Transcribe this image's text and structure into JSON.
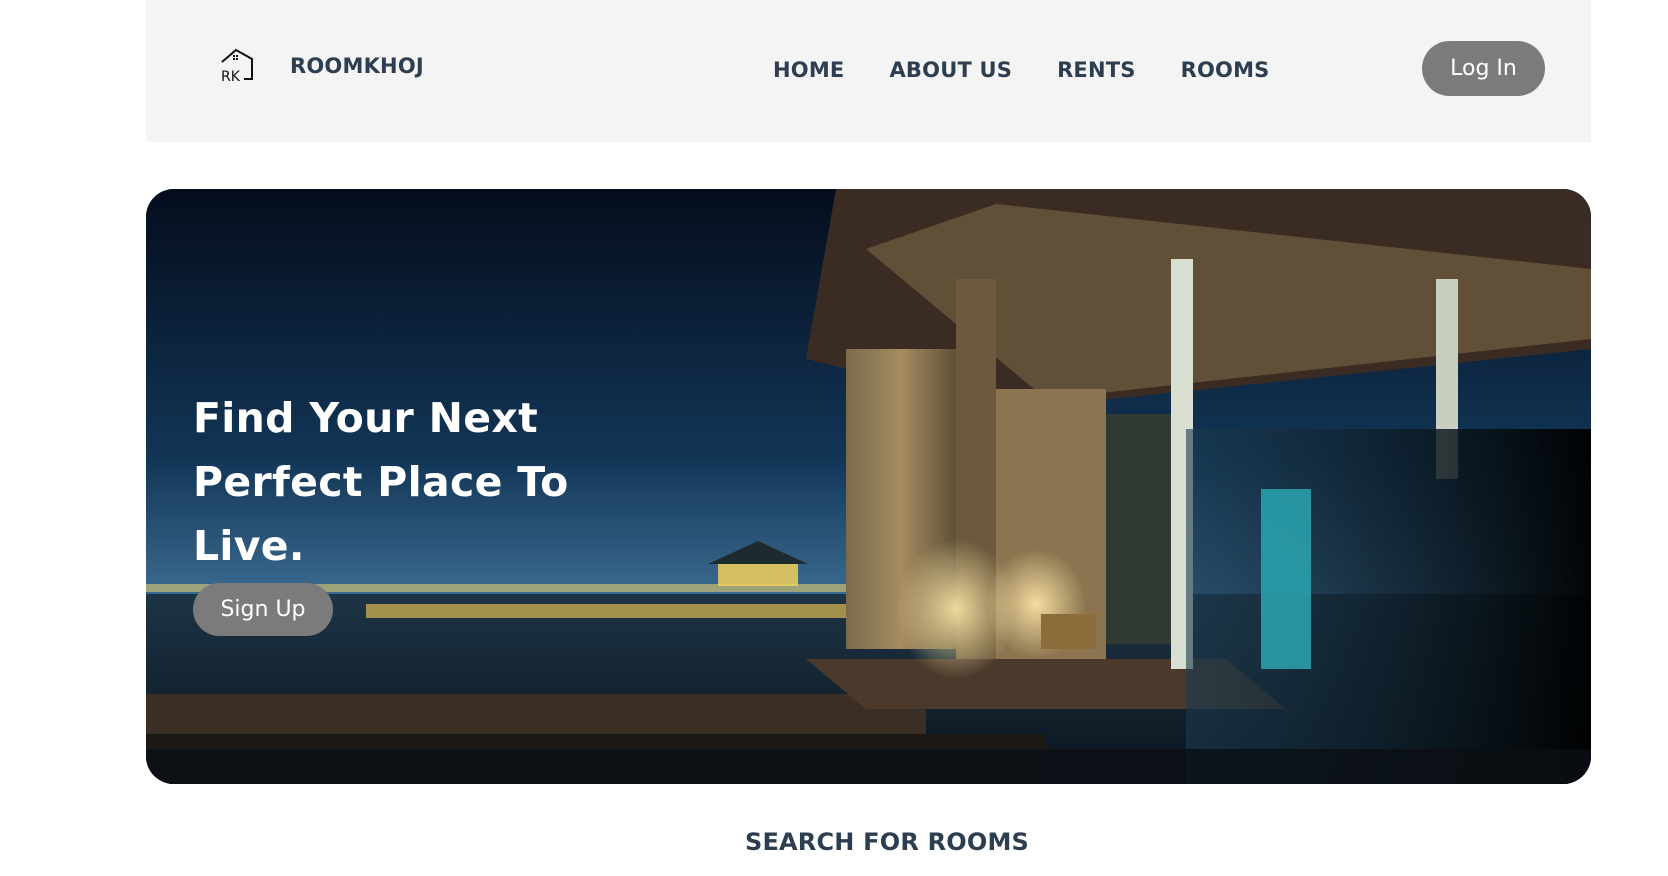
{
  "brand": {
    "logo_text": "RK",
    "name": "ROOMKHOJ"
  },
  "nav": {
    "links": [
      "HOME",
      "ABOUT US",
      "RENTS",
      "ROOMS"
    ]
  },
  "header": {
    "login_label": "Log In"
  },
  "hero": {
    "title": "Find Your Next Perfect Place To Live.",
    "signup_label": "Sign Up",
    "image_alt": "Night view of a waterfront resort with a wooden boardwalk, lit pavilion and harbour lights"
  },
  "search": {
    "heading": "SEARCH FOR ROOMS"
  },
  "colors": {
    "nav_text": "#2d3e50",
    "button_bg": "#7b7b7b",
    "header_bg": "#f4f4f4"
  },
  "icons": [
    "house-logo-icon"
  ]
}
